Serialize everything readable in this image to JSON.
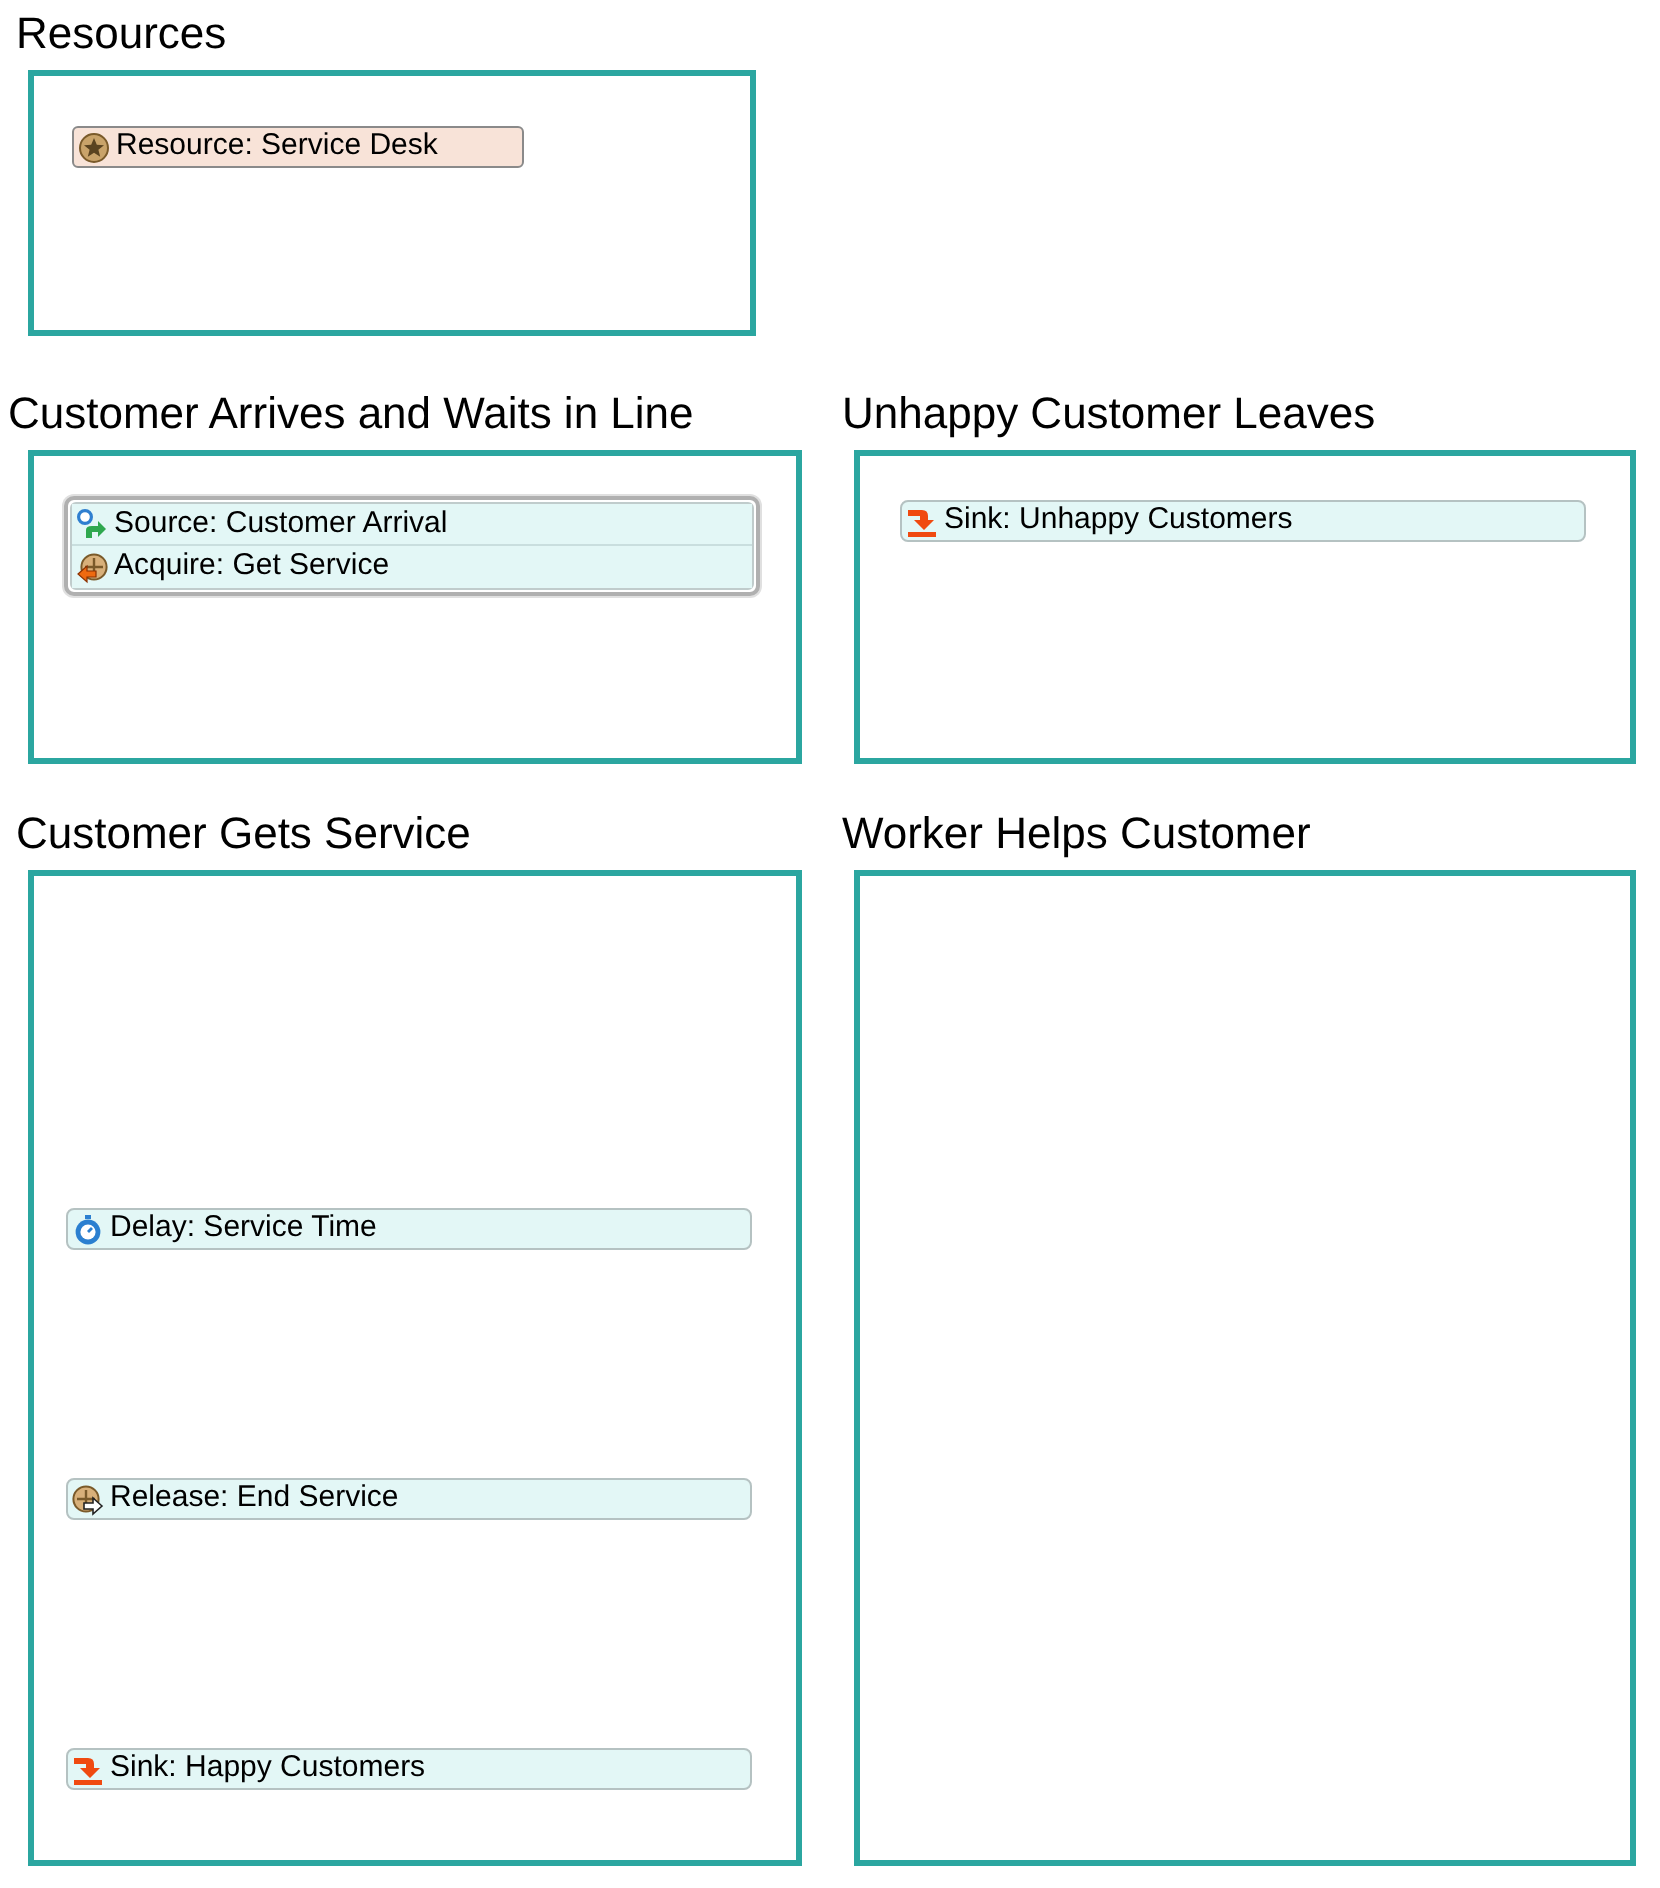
{
  "lanes": [
    {
      "title": "Resources",
      "items": [
        {
          "kind": "resource",
          "label": "Resource: Service Desk"
        }
      ]
    },
    {
      "title": "Customer Arrives and Waits in Line",
      "items": [
        {
          "kind": "group",
          "children": [
            {
              "kind": "source",
              "label": "Source: Customer Arrival"
            },
            {
              "kind": "acquire",
              "label": "Acquire: Get Service"
            }
          ]
        }
      ]
    },
    {
      "title": "Unhappy Customer Leaves",
      "items": [
        {
          "kind": "sink",
          "label": "Sink: Unhappy Customers"
        }
      ]
    },
    {
      "title": "Customer Gets Service",
      "items": [
        {
          "kind": "delay",
          "label": "Delay: Service Time"
        },
        {
          "kind": "release",
          "label": "Release: End Service"
        },
        {
          "kind": "sink",
          "label": "Sink: Happy Customers"
        }
      ]
    },
    {
      "title": "Worker Helps Customer"
    }
  ]
}
